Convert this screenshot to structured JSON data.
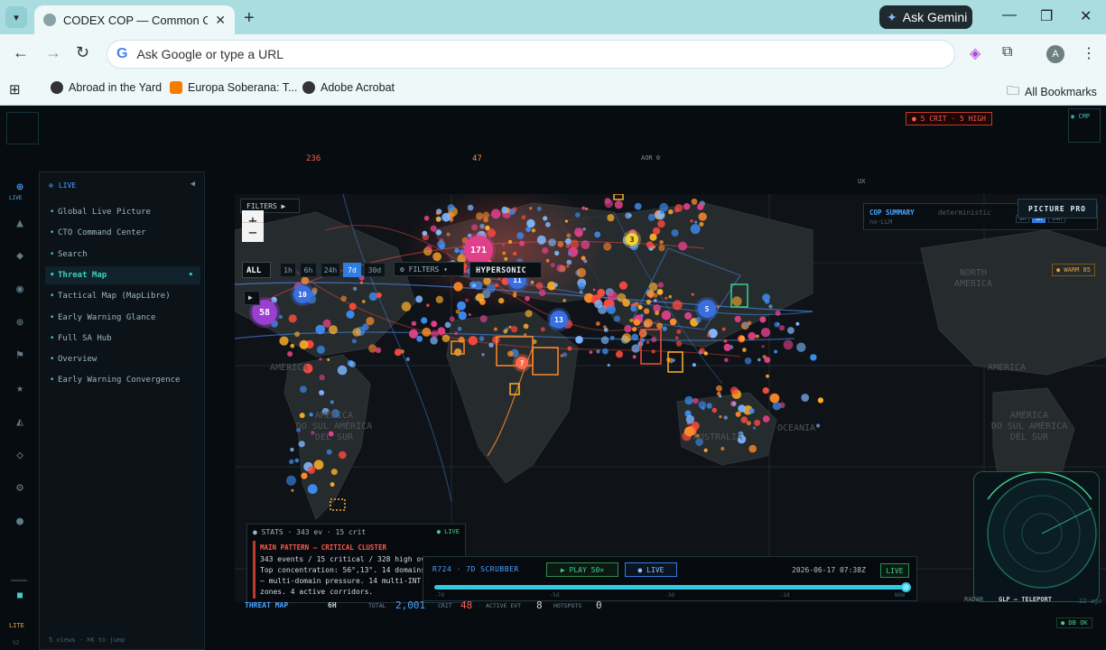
{
  "browser": {
    "tab_title": "CODEX COP — Common Opera",
    "gemini_label": "Ask Gemini",
    "omnibox_placeholder": "Ask Google or type a URL",
    "avatar_letter": "A",
    "bookmarks": [
      "Abroad in the Yard",
      "Europa Soberana: T...",
      "Adobe Acrobat"
    ],
    "all_bookmarks": "All Bookmarks"
  },
  "header": {
    "top_numbers": [
      {
        "value": "236",
        "color": "#ff5a4d"
      },
      {
        "value": "47",
        "color": "#ff8a3d"
      },
      {
        "value": "AOR 0",
        "color": "#7b8f9a"
      },
      {
        "value": "UX",
        "color": "#7b8f9a"
      }
    ],
    "crit_badge": "● 5 CRIT · 5 HIGH",
    "cmp_label": "◉ CMP"
  },
  "rail": {
    "live_label": "LIVE",
    "lite_label": "LITE",
    "version": "V2",
    "icons": [
      "globe-icon",
      "triangle-icon",
      "diamond-icon",
      "target-icon",
      "crosshair-icon",
      "flag-icon",
      "star-icon",
      "warning-icon",
      "rhombus-icon",
      "gear-icon",
      "dot-icon"
    ]
  },
  "sidepanel": {
    "header": "LIVE",
    "items": [
      {
        "label": "Global Live Picture",
        "active": false
      },
      {
        "label": "CTO Command Center",
        "active": false
      },
      {
        "label": "Search",
        "active": false
      },
      {
        "label": "Threat Map",
        "active": true
      },
      {
        "label": "Tactical Map (MapLibre)",
        "active": false
      },
      {
        "label": "Early Warning Glance",
        "active": false
      },
      {
        "label": "Full SA Hub",
        "active": false
      },
      {
        "label": "Overview",
        "active": false
      },
      {
        "label": "Early Warning Convergence",
        "active": false
      }
    ],
    "footer": "5 views · ⌘K to jump"
  },
  "map": {
    "filters_label": "FILTERS ▶",
    "zoom_in": "+",
    "zoom_out": "−",
    "all_label": "ALL",
    "time_ranges": [
      "1h",
      "6h",
      "24h",
      "7d",
      "30d"
    ],
    "selected_time_range": "7d",
    "filters_button": "⚙ FILTERS ▾",
    "hypersonic_label": "HYPERSONIC",
    "play_side": "▶",
    "region_labels": [
      {
        "text": "NORTH AMERICA",
        "lines": [
          "NORTH",
          "AMERICA"
        ]
      },
      {
        "text": "AMÉRICA DO SUL AMÉRICA DEL SUR",
        "lines": [
          "AMÉRICA",
          "DO SUL AMÉRICA",
          "DEL SUR"
        ]
      },
      {
        "text": "OCEANIA",
        "lines": [
          "OCEANIA"
        ]
      },
      {
        "text": "AUSTRALIA",
        "lines": [
          "AUSTRALIA"
        ]
      },
      {
        "text": "AMÉRICA DO SUL AMÉRICA DEL SUR",
        "lines": [
          "AMÉRICA",
          "DO SUL AMÉRICA",
          "DEL SUR"
        ]
      },
      {
        "text": "AMERICA",
        "lines": [
          "AMERICA"
        ]
      },
      {
        "text": "AMERICA",
        "lines": [
          "AMERICA"
        ]
      }
    ],
    "clusters": [
      {
        "label": "171",
        "color": "#e0408a"
      },
      {
        "label": "11",
        "color": "#3b6fe0"
      },
      {
        "label": "10",
        "color": "#3b6fe0"
      },
      {
        "label": "58",
        "color": "#9b3fd0"
      },
      {
        "label": "13",
        "color": "#3b6fe0"
      },
      {
        "label": "5",
        "color": "#3b6fe0"
      },
      {
        "label": "3",
        "color": "#f2d23a"
      },
      {
        "label": "?",
        "color": "#ff6a4a"
      }
    ],
    "cop_summary_label": "COP SUMMARY",
    "cop_summary_mode": "deterministic",
    "cop_summary_sub": "no-LLM",
    "cop_summary_tabs": [
      "1h",
      "6h",
      "24h"
    ],
    "picture_pro": "PICTURE PRO",
    "warm_label": "● WARM 85"
  },
  "stats": {
    "title": "● STATS · 343 ev · 15 crit",
    "live_badge": "● LIVE",
    "pattern_title": "MAIN PATTERN — CRITICAL CLUSTER",
    "lines": [
      "343 events / 15 critical / 328 high ove",
      "Top concentration: 56°,13°. 14 domains",
      "— multi-domain pressure. 14 multi-INT f",
      "zones. 4 active corridors."
    ]
  },
  "scrubber": {
    "title": "R724 · 7D SCRUBBER",
    "play_label": "▶ PLAY 50×",
    "live_button": "● LIVE",
    "timestamp": "2026-06-17 07:38Z",
    "live_tag": "LIVE",
    "ticks": [
      "-7d",
      "-5d",
      "-3d",
      "-1d",
      "NOW"
    ],
    "progress": 1.0
  },
  "bottombar": {
    "threat_map": "THREAT MAP",
    "window": "6H",
    "total_label": "TOTAL",
    "total_value": "2,001",
    "crit_label": "CRIT",
    "crit_value": "48",
    "active_label": "ACTIVE EVT",
    "active_value": "8",
    "hotspots_label": "HOTSPOTS",
    "hotspots_value": "0"
  },
  "radar": {
    "radar_label": "RADAR",
    "teleport_label": "GLP — TELEPORT",
    "ago": "22 ago",
    "db_status": "● DB OK"
  },
  "colors": {
    "accent": "#3fd0c0",
    "link_blue": "#4aa3ff",
    "critical": "#ff4a3d",
    "event_blue": "#3d8cf0",
    "event_orange": "#ff8a2a",
    "event_magenta": "#e0408a"
  }
}
